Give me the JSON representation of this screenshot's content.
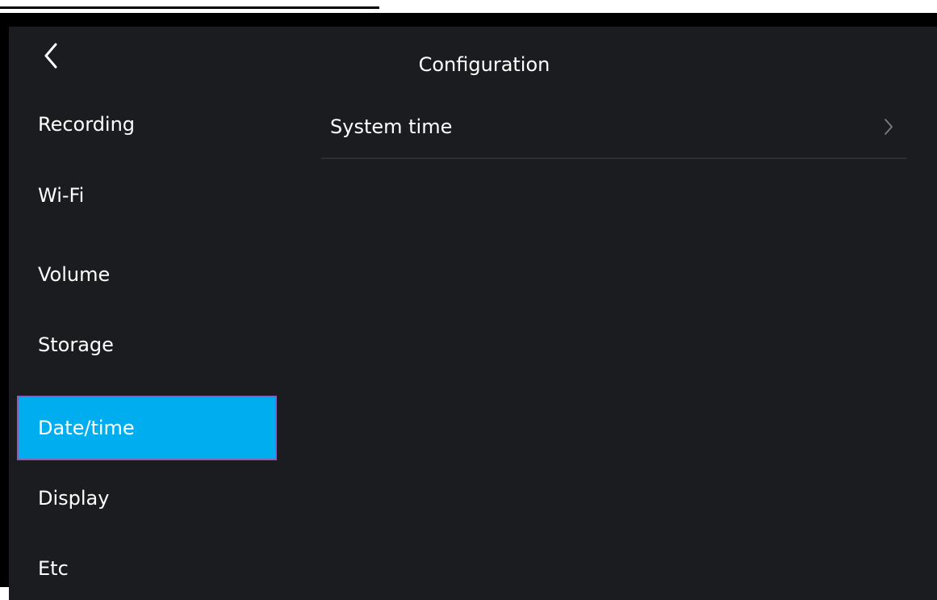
{
  "header": {
    "title": "Configuration"
  },
  "sidebar": {
    "items": [
      {
        "label": "Recording",
        "selected": false
      },
      {
        "label": "Wi-Fi",
        "selected": false
      },
      {
        "label": "Volume",
        "selected": false
      },
      {
        "label": "Storage",
        "selected": false
      },
      {
        "label": "Date/time",
        "selected": true
      },
      {
        "label": "Display",
        "selected": false
      },
      {
        "label": "Etc",
        "selected": false
      }
    ]
  },
  "main": {
    "rows": [
      {
        "label": "System time",
        "icon": "chevron-right-icon"
      }
    ]
  },
  "colors": {
    "background": "#1b1c1f",
    "accent": "#00aeef",
    "selection_border": "#8c5fb7",
    "divider": "#2c2e31"
  }
}
